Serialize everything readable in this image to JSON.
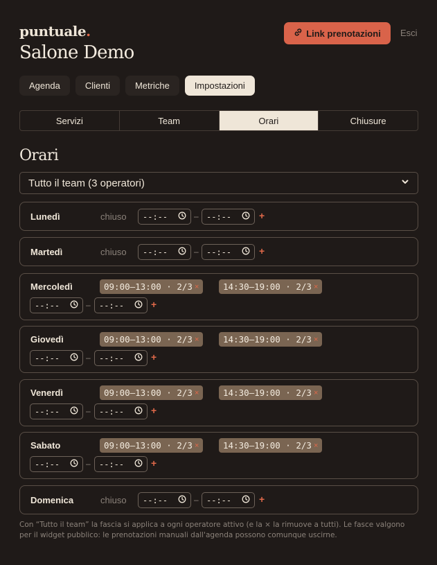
{
  "header": {
    "logo_text": "puntuale",
    "logo_dot": ".",
    "salon_name": "Salone Demo",
    "link_button_label": "Link prenotazioni",
    "logout_label": "Esci"
  },
  "main_nav": [
    "Agenda",
    "Clienti",
    "Metriche",
    "Impostazioni"
  ],
  "sub_tabs": [
    "Servizi",
    "Team",
    "Orari",
    "Chiusure"
  ],
  "section_title": "Orari",
  "team_select": {
    "value": "Tutto il team (3 operatori)"
  },
  "time_placeholder": "--:--",
  "dash": "–",
  "add_label": "+",
  "remove_label": "×",
  "days": [
    {
      "name": "Lunedì",
      "status": "chiuso",
      "slots": []
    },
    {
      "name": "Martedì",
      "status": "chiuso",
      "slots": []
    },
    {
      "name": "Mercoledì",
      "status": "",
      "slots": [
        "09:00–13:00 · 2/3",
        "14:30–19:00 · 2/3"
      ]
    },
    {
      "name": "Giovedì",
      "status": "",
      "slots": [
        "09:00–13:00 · 2/3",
        "14:30–19:00 · 2/3"
      ]
    },
    {
      "name": "Venerdì",
      "status": "",
      "slots": [
        "09:00–13:00 · 2/3",
        "14:30–19:00 · 2/3"
      ]
    },
    {
      "name": "Sabato",
      "status": "",
      "slots": [
        "09:00–13:00 · 2/3",
        "14:30–19:00 · 2/3"
      ]
    },
    {
      "name": "Domenica",
      "status": "chiuso",
      "slots": []
    }
  ],
  "footnote": "Con “Tutto il team” la fascia si applica a ogni operatore attivo (e la × la rimuove a tutti). Le fasce valgono per il widget pubblico: le prenotazioni manuali dall'agenda possono comunque uscirne.",
  "colors": {
    "background": "#1f1a18",
    "accent": "#d9634a",
    "chip": "#7a6552",
    "text": "#efe6d8"
  }
}
